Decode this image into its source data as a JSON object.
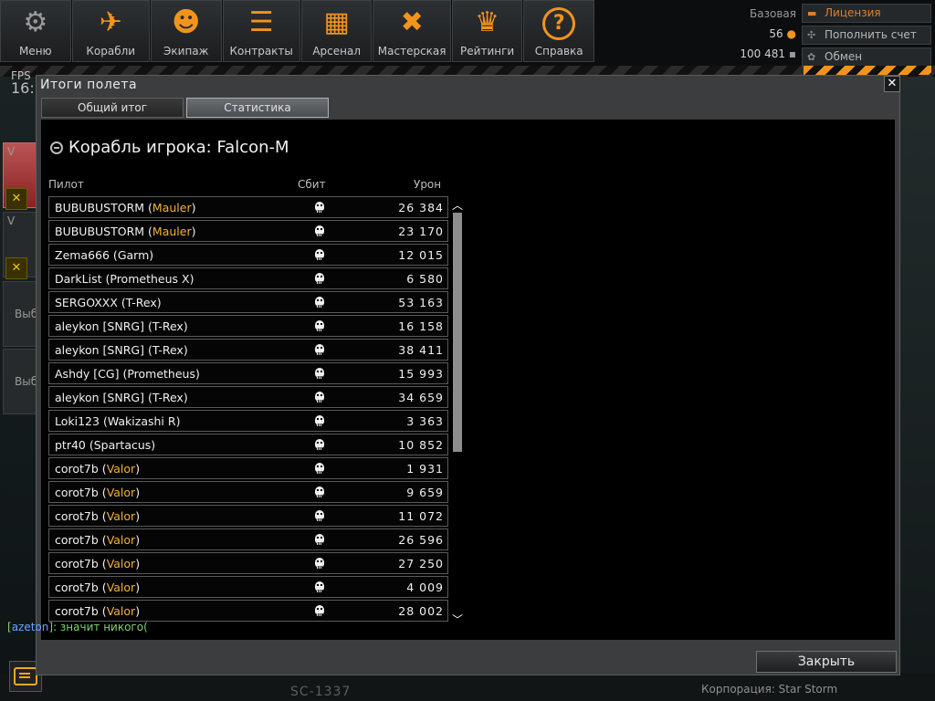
{
  "nav": [
    {
      "label": "Меню",
      "icon": "gear-skull-icon"
    },
    {
      "label": "Корабли",
      "icon": "ships-icon"
    },
    {
      "label": "Экипаж",
      "icon": "crew-icon"
    },
    {
      "label": "Контракты",
      "icon": "contract-icon"
    },
    {
      "label": "Арсенал",
      "icon": "arsenal-crates-icon"
    },
    {
      "label": "Мастерская",
      "icon": "workshop-tools-icon"
    },
    {
      "label": "Рейтинги",
      "icon": "ratings-wings-icon"
    },
    {
      "label": "Справка",
      "icon": "help-question-icon"
    }
  ],
  "account": {
    "tier": "Базовая",
    "gold": "56",
    "credits": "100 481",
    "license_label": "Лицензия",
    "topup_label": "Пополнить счет",
    "exchange_label": "Обмен"
  },
  "hud": {
    "fps_label": "FPS",
    "time": "16:",
    "left_cards": [
      "V",
      "V"
    ],
    "left_card_text": [
      "Выб",
      "Выб"
    ],
    "ship_code": "SC-1337",
    "corp": "Корпорация: Star Storm"
  },
  "chat": {
    "nick": "azeton",
    "message": ": значит никого("
  },
  "dialog": {
    "title": "Итоги полета",
    "close_glyph": "✕",
    "tabs": [
      {
        "label": "Общий итог",
        "active": false
      },
      {
        "label": "Статистика",
        "active": true
      }
    ],
    "ship_heading": "Корабль игрока: Falcon-M",
    "columns": {
      "pilot": "Пилот",
      "kills": "Сбит",
      "damage": "Урон"
    },
    "rows": [
      {
        "name": "BUBUBUSTORM",
        "ship": "Mauler",
        "ship_gold": true,
        "damage": "26 384"
      },
      {
        "name": "BUBUBUSTORM",
        "ship": "Mauler",
        "ship_gold": true,
        "damage": "23 170"
      },
      {
        "name": "Zema666",
        "ship": "Garm",
        "ship_gold": false,
        "damage": "12 015"
      },
      {
        "name": "DarkList",
        "ship": "Prometheus X",
        "ship_gold": false,
        "damage": "6 580"
      },
      {
        "name": "SERGOXXX",
        "ship": "T-Rex",
        "ship_gold": false,
        "damage": "53 163"
      },
      {
        "name": "aleykon [SNRG]",
        "ship": "T-Rex",
        "ship_gold": false,
        "damage": "16 158"
      },
      {
        "name": "aleykon [SNRG]",
        "ship": "T-Rex",
        "ship_gold": false,
        "damage": "38 411"
      },
      {
        "name": "Ashdy [CG]",
        "ship": "Prometheus",
        "ship_gold": false,
        "damage": "15 993"
      },
      {
        "name": "aleykon [SNRG]",
        "ship": "T-Rex",
        "ship_gold": false,
        "damage": "34 659"
      },
      {
        "name": "Loki123",
        "ship": "Wakizashi R",
        "ship_gold": false,
        "damage": "3 363"
      },
      {
        "name": "ptr40",
        "ship": "Spartacus",
        "ship_gold": false,
        "damage": "10 852"
      },
      {
        "name": "corot7b",
        "ship": "Valor",
        "ship_gold": true,
        "damage": "1 931"
      },
      {
        "name": "corot7b",
        "ship": "Valor",
        "ship_gold": true,
        "damage": "9 659"
      },
      {
        "name": "corot7b",
        "ship": "Valor",
        "ship_gold": true,
        "damage": "11 072"
      },
      {
        "name": "corot7b",
        "ship": "Valor",
        "ship_gold": true,
        "damage": "26 596"
      },
      {
        "name": "corot7b",
        "ship": "Valor",
        "ship_gold": true,
        "damage": "27 250"
      },
      {
        "name": "corot7b",
        "ship": "Valor",
        "ship_gold": true,
        "damage": "4 009"
      },
      {
        "name": "corot7b",
        "ship": "Valor",
        "ship_gold": true,
        "damage": "28 002"
      }
    ],
    "close_button": "Закрыть"
  },
  "colors": {
    "accent": "#f2941c",
    "ship_gold": "#f2b233",
    "chat_green": "#7fd16b",
    "chat_nick": "#6aa7ff"
  }
}
